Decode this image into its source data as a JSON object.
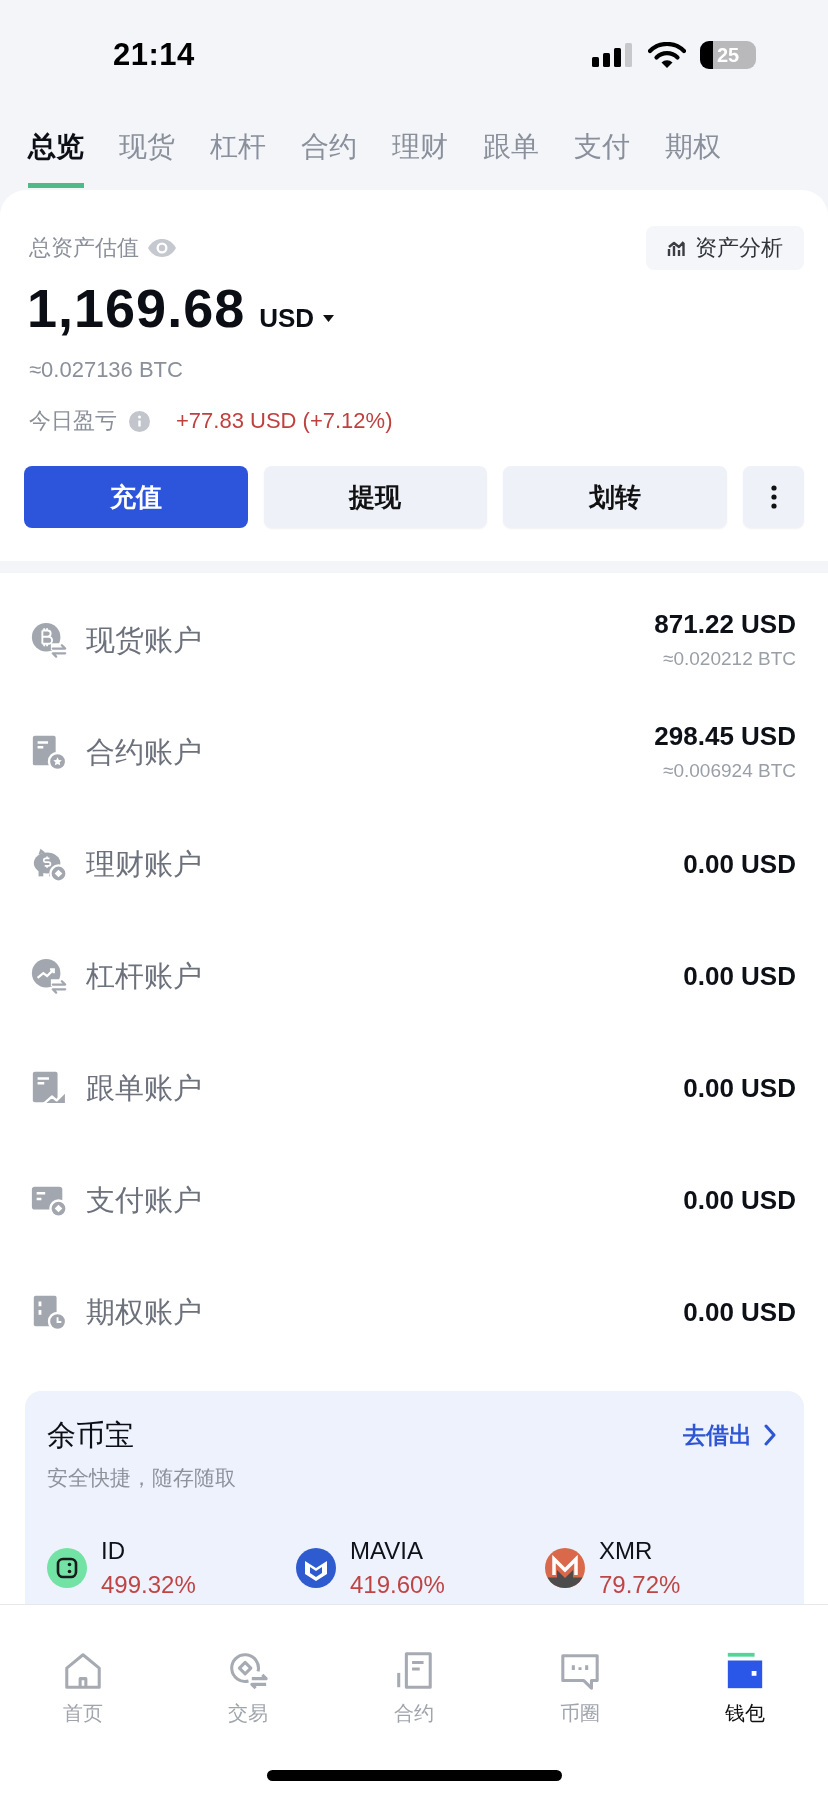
{
  "status_bar": {
    "time": "21:14",
    "battery": "25"
  },
  "tabs": [
    {
      "label": "总览",
      "selected": true
    },
    {
      "label": "现货",
      "selected": false
    },
    {
      "label": "杠杆",
      "selected": false
    },
    {
      "label": "合约",
      "selected": false
    },
    {
      "label": "理财",
      "selected": false
    },
    {
      "label": "跟单",
      "selected": false
    },
    {
      "label": "支付",
      "selected": false
    },
    {
      "label": "期权",
      "selected": false
    }
  ],
  "overview": {
    "title": "总资产估值",
    "analysis_button": "资产分析",
    "total": "1,169.68",
    "currency": "USD",
    "btc_equivalent": "≈0.027136 BTC",
    "pnl_label": "今日盈亏",
    "pnl_value": "+77.83 USD (+7.12%)"
  },
  "actions": [
    {
      "kind": "primary",
      "label": "充值"
    },
    {
      "kind": "secondary",
      "label": "提现"
    },
    {
      "kind": "secondary",
      "label": "划转"
    },
    {
      "kind": "more"
    }
  ],
  "accounts": [
    {
      "kind": "spot",
      "name": "现货账户",
      "amount": "871.22 USD",
      "btc": "≈0.020212 BTC"
    },
    {
      "kind": "futures",
      "name": "合约账户",
      "amount": "298.45 USD",
      "btc": "≈0.006924 BTC"
    },
    {
      "kind": "earn",
      "name": "理财账户",
      "amount": "0.00 USD"
    },
    {
      "kind": "margin",
      "name": "杠杆账户",
      "amount": "0.00 USD"
    },
    {
      "kind": "copy",
      "name": "跟单账户",
      "amount": "0.00 USD"
    },
    {
      "kind": "pay",
      "name": "支付账户",
      "amount": "0.00 USD"
    },
    {
      "kind": "options",
      "name": "期权账户",
      "amount": "0.00 USD"
    }
  ],
  "savings": {
    "title": "余币宝",
    "link": "去借出",
    "subtitle": "安全快捷，随存随取",
    "coins": [
      {
        "kind": "id",
        "symbol": "ID",
        "rate": "499.32%"
      },
      {
        "kind": "mavia",
        "symbol": "MAVIA",
        "rate": "419.60%"
      },
      {
        "kind": "xmr",
        "symbol": "XMR",
        "rate": "79.72%"
      }
    ]
  },
  "bottom_nav": [
    {
      "kind": "home",
      "label": "首页",
      "selected": false
    },
    {
      "kind": "trade",
      "label": "交易",
      "selected": false
    },
    {
      "kind": "contract",
      "label": "合约",
      "selected": false
    },
    {
      "kind": "community",
      "label": "币圈",
      "selected": false
    },
    {
      "kind": "wallet",
      "label": "钱包",
      "selected": true
    }
  ]
}
